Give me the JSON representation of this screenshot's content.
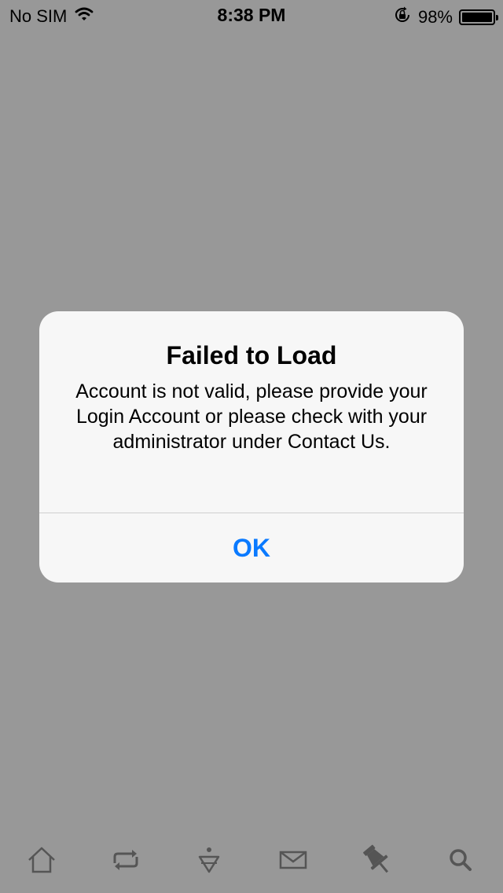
{
  "status_bar": {
    "carrier": "No SIM",
    "time": "8:38 PM",
    "battery_percent": "98%",
    "icons": [
      "wifi-icon",
      "rotation-lock-icon",
      "battery-icon"
    ]
  },
  "alert": {
    "title": "Failed to Load",
    "message": "Account is not valid, please provide your Login Account or please check with your administrator under Contact Us.",
    "ok_label": "OK",
    "accent_color": "#0a7aff"
  },
  "tab_bar": {
    "items": [
      "home-icon",
      "sync-icon",
      "download-icon",
      "mail-icon",
      "pin-icon",
      "search-icon"
    ]
  },
  "colors": {
    "overlay_background": "#989898",
    "dialog_background": "#f7f7f7"
  }
}
